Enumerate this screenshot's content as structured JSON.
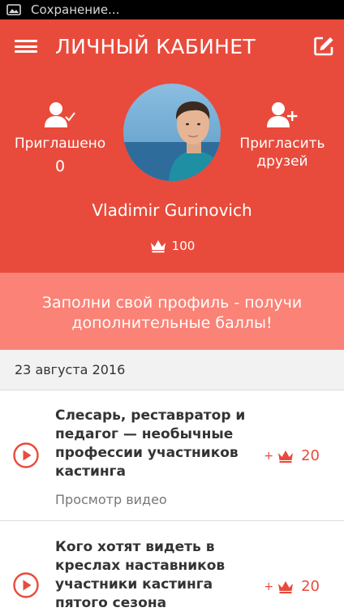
{
  "status_bar": {
    "text": "Сохранение..."
  },
  "header": {
    "title": "ЛИЧНЫЙ КАБИНЕТ",
    "invited": {
      "label": "Приглашено",
      "value": "0"
    },
    "invite_friends": {
      "label": "Пригласить друзей"
    },
    "user_name": "Vladimir Gurinovich",
    "score": "100"
  },
  "promo": {
    "text": "Заполни свой профиль - получи дополнительные баллы!"
  },
  "feed": {
    "date": "23 августа 2016",
    "items": [
      {
        "title": "Слесарь, реставратор и педагог — необычные профессии участников кастинга",
        "subtitle": "Просмотр видео",
        "plus": "+",
        "points": "20"
      },
      {
        "title": "Кого хотят видеть в креслах наставников участники кастинга пятого сезона",
        "plus": "+",
        "points": "20"
      }
    ]
  },
  "colors": {
    "primary": "#e84b3c",
    "promo": "#fb8276",
    "date_bg": "#f2f2f2"
  },
  "icons": [
    "image-icon",
    "menu-icon",
    "edit-icon",
    "user-check-icon",
    "user-add-icon",
    "crown-icon",
    "play-icon"
  ]
}
